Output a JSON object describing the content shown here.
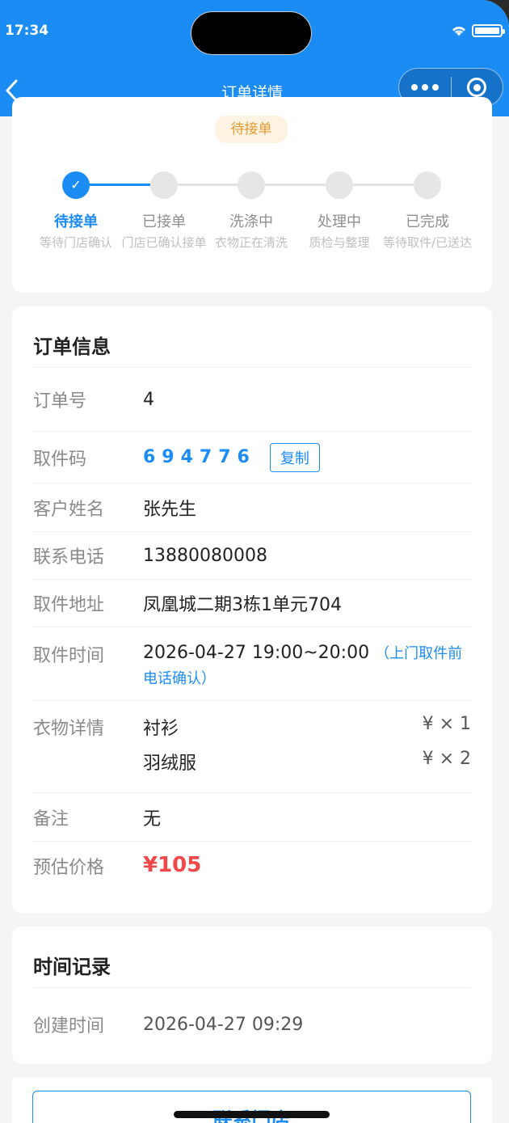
{
  "status_bar": {
    "time": "17:34"
  },
  "nav": {
    "title": "订单详情"
  },
  "order_status": {
    "badge": "待接单",
    "steps": [
      {
        "label": "待接单",
        "sub": "等待门店确认"
      },
      {
        "label": "已接单",
        "sub": "门店已确认接单"
      },
      {
        "label": "洗涤中",
        "sub": "衣物正在清洗"
      },
      {
        "label": "处理中",
        "sub": "质检与整理"
      },
      {
        "label": "已完成",
        "sub": "等待取件/已送达"
      }
    ]
  },
  "order_info": {
    "title": "订单信息",
    "order_no_label": "订单号",
    "order_no": "4",
    "pickup_code_label": "取件码",
    "pickup_code": "694776",
    "copy_label": "复制",
    "customer_label": "客户姓名",
    "customer": "张先生",
    "phone_label": "联系电话",
    "phone": "13880080008",
    "address_label": "取件地址",
    "address": "凤凰城二期3栋1单元704",
    "pickup_time_label": "取件时间",
    "pickup_time": "2026-04-27 19:00~20:00",
    "pickup_hint": "（上门取件前电话确认）",
    "clothes_label": "衣物详情",
    "clothes": [
      {
        "name": "衬衫",
        "qty": "¥ × 1"
      },
      {
        "name": "羽绒服",
        "qty": "¥ × 2"
      }
    ],
    "remark_label": "备注",
    "remark": "无",
    "price_label": "预估价格",
    "price": "¥105"
  },
  "time_record": {
    "title": "时间记录",
    "created_label": "创建时间",
    "created": "2026-04-27 09:29"
  },
  "contact_button": "联系门店"
}
